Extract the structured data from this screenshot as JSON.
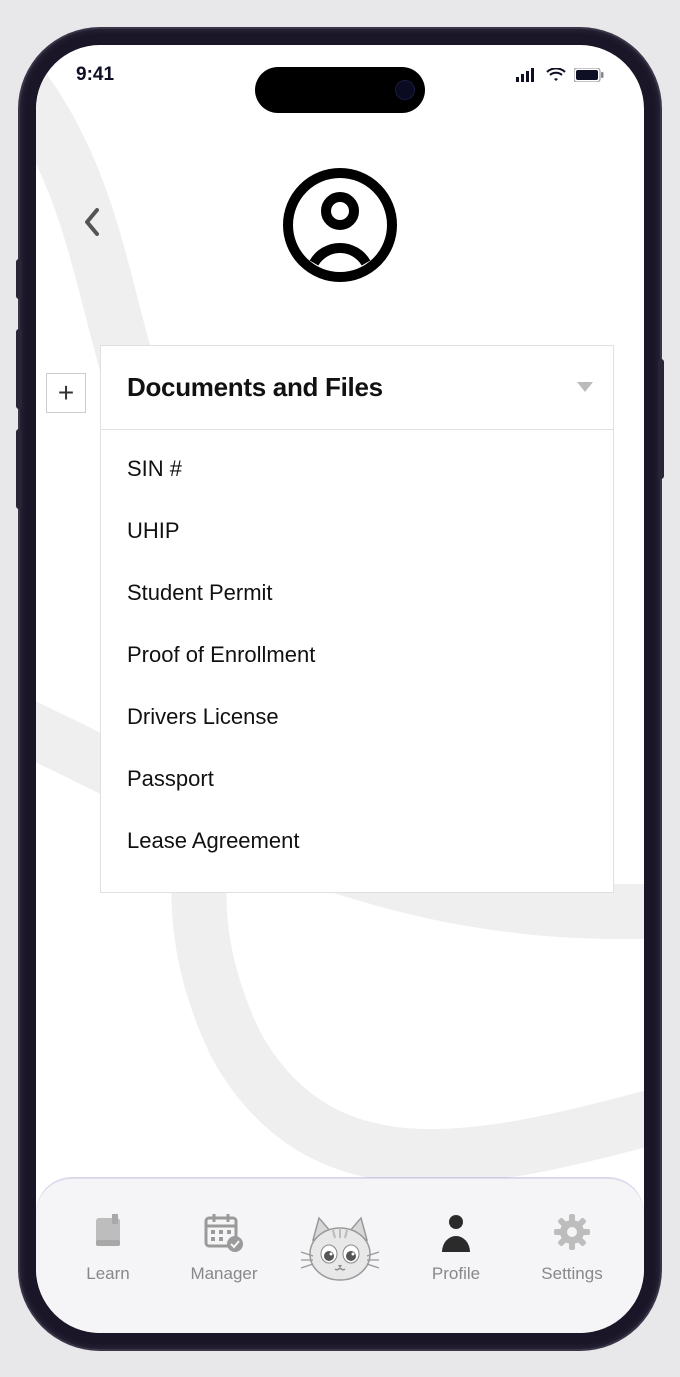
{
  "status": {
    "time": "9:41"
  },
  "panel": {
    "title": "Documents and Files",
    "items": [
      "SIN #",
      "UHIP",
      "Student Permit",
      "Proof of Enrollment",
      "Drivers License",
      "Passport",
      "Lease Agreement"
    ]
  },
  "nav": {
    "learn": "Learn",
    "manager": "Manager",
    "profile": "Profile",
    "settings": "Settings"
  }
}
